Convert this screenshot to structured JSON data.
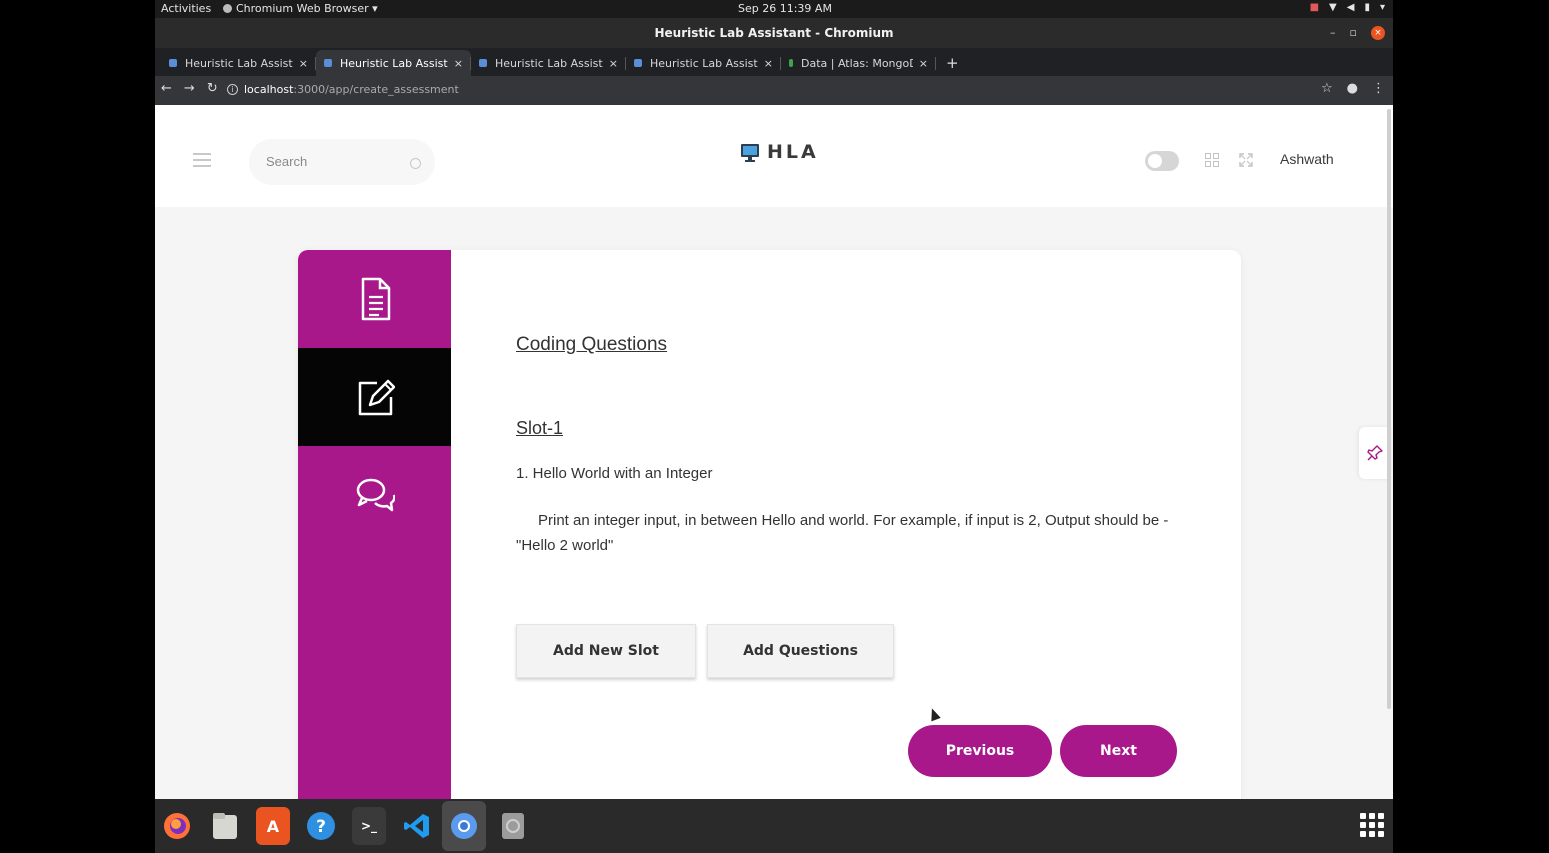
{
  "system_bar": {
    "activities": "Activities",
    "app_menu": "Chromium Web Browser ▾",
    "clock": "Sep 26  11:39 AM",
    "tray_icons": [
      "camera-icon",
      "wifi-icon",
      "volume-icon",
      "battery-icon",
      "power-menu-icon"
    ]
  },
  "window": {
    "title": "Heuristic Lab Assistant - Chromium"
  },
  "tabs": [
    {
      "label": "Heuristic Lab Assistant",
      "close": "×"
    },
    {
      "label": "Heuristic Lab Assistant",
      "close": "×",
      "active": true
    },
    {
      "label": "Heuristic Lab Assistant",
      "close": "×"
    },
    {
      "label": "Heuristic Lab Assistant",
      "close": "×"
    },
    {
      "label": "Data | Atlas: MongoDB A",
      "close": "×"
    }
  ],
  "new_tab": "+",
  "address_bar": {
    "host": "localhost",
    "path": ":3000/app/create_assessment"
  },
  "header": {
    "search_placeholder": "Search",
    "logo_text": "HLA",
    "username": "Ashwath"
  },
  "sidebar": {
    "items": [
      {
        "icon": "document-icon"
      },
      {
        "icon": "edit-icon",
        "active": true
      },
      {
        "icon": "chat-icon"
      }
    ]
  },
  "content": {
    "section_title": "Coding Questions",
    "slot_title": "Slot-1",
    "question_title": "1. Hello World with an Integer",
    "question_description": "Print an integer input, in between Hello and world. For example, if input is 2, Output should be - \"Hello 2 world\"",
    "add_slot_label": "Add New Slot",
    "add_questions_label": "Add Questions",
    "previous_label": "Previous",
    "next_label": "Next"
  },
  "colors": {
    "brand": "#a8188b",
    "sidebar_active": "#050505"
  },
  "dock": [
    "firefox-icon",
    "files-icon",
    "software-icon",
    "help-icon",
    "terminal-icon",
    "vscode-icon",
    "chromium-icon",
    "disk-icon",
    "show-apps-icon"
  ]
}
